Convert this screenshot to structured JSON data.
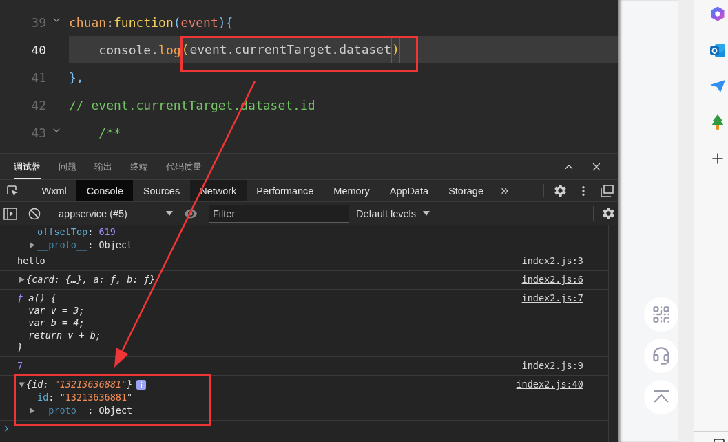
{
  "editor": {
    "lines": [
      {
        "number": "39",
        "foldable": true,
        "current": false,
        "tokens": [
          {
            "text": "chuan",
            "kind": "property"
          },
          {
            "text": ":",
            "kind": "punct"
          },
          {
            "text": "function",
            "kind": "keyword"
          },
          {
            "text": "(",
            "kind": "bracket"
          },
          {
            "text": "event",
            "kind": "param"
          },
          {
            "text": "){",
            "kind": "bracket"
          }
        ]
      },
      {
        "number": "40",
        "foldable": false,
        "current": true,
        "tokens": [
          {
            "text": "    console.",
            "kind": "plain"
          },
          {
            "text": "log",
            "kind": "method"
          },
          {
            "text": "(",
            "kind": "match"
          },
          {
            "text": "event.currentTarget.dataset",
            "kind": "arg"
          },
          {
            "text": ")",
            "kind": "match"
          }
        ]
      },
      {
        "number": "41",
        "foldable": false,
        "current": false,
        "tokens": [
          {
            "text": "},",
            "kind": "bracket"
          }
        ]
      },
      {
        "number": "42",
        "foldable": false,
        "current": false,
        "tokens": [
          {
            "text": "// event.currentTarget.dataset.id",
            "kind": "comment"
          }
        ]
      },
      {
        "number": "43",
        "foldable": true,
        "current": false,
        "tokens": [
          {
            "text": "    /**",
            "kind": "comment"
          }
        ]
      }
    ]
  },
  "panel_tabs": [
    {
      "label": "调试器",
      "selected": true
    },
    {
      "label": "问题",
      "selected": false
    },
    {
      "label": "输出",
      "selected": false
    },
    {
      "label": "终端",
      "selected": false
    },
    {
      "label": "代码质量",
      "selected": false
    }
  ],
  "devtools_tabs": [
    {
      "label": "Wxml",
      "selected": false,
      "hovered": false
    },
    {
      "label": "Console",
      "selected": true,
      "hovered": false
    },
    {
      "label": "Sources",
      "selected": false,
      "hovered": false
    },
    {
      "label": "Network",
      "selected": false,
      "hovered": true
    },
    {
      "label": "Performance",
      "selected": false,
      "hovered": false
    },
    {
      "label": "Memory",
      "selected": false,
      "hovered": false
    },
    {
      "label": "AppData",
      "selected": false,
      "hovered": false
    },
    {
      "label": "Storage",
      "selected": false,
      "hovered": false
    }
  ],
  "console_toolbar": {
    "context": "appservice (#5)",
    "filter": {
      "placeholder": "Filter"
    },
    "levels": "Default levels"
  },
  "console": {
    "messages": [
      {
        "kind": "continuation",
        "info": false,
        "nodes": [
          {
            "kind": "value",
            "tokens": [
              {
                "text": "offsetTop",
                "kind": "key"
              },
              {
                "text": ": ",
                "kind": "plain"
              },
              {
                "text": "619",
                "kind": "number"
              }
            ]
          },
          {
            "kind": "object",
            "expanded": false,
            "tokens": [
              {
                "text": "__proto__",
                "kind": "internal-key"
              },
              {
                "text": ": Object",
                "kind": "plain"
              }
            ]
          }
        ]
      },
      {
        "kind": "log",
        "source": "index2.js:3",
        "info": false,
        "nodes": [
          {
            "kind": "value",
            "tokens": [
              {
                "text": "hello",
                "kind": "plain"
              }
            ]
          }
        ]
      },
      {
        "kind": "log",
        "source": "index2.js:6",
        "info": false,
        "nodes": [
          {
            "kind": "object",
            "expanded": false,
            "tokens": [
              {
                "text": "{card: {…}, a: ƒ, b: ƒ}",
                "kind": "italic"
              }
            ]
          }
        ]
      },
      {
        "kind": "log",
        "source": "index2.js:7",
        "info": false,
        "nodes": [
          {
            "kind": "value",
            "tokens": [
              {
                "text": "ƒ",
                "kind": "function-sign"
              },
              {
                "text": " a() {\n  var v = 3;\n  var b = 4;\n  return v + b;\n}",
                "kind": "italic"
              }
            ]
          }
        ]
      },
      {
        "kind": "log",
        "source": "index2.js:9",
        "info": false,
        "nodes": [
          {
            "kind": "value",
            "tokens": [
              {
                "text": "7",
                "kind": "number"
              }
            ]
          }
        ]
      },
      {
        "kind": "log",
        "source": "index2.js:40",
        "info": true,
        "nodes": [
          {
            "kind": "object",
            "expanded": true,
            "tokens": [
              {
                "text": "{id: ",
                "kind": "italic"
              },
              {
                "text": "\"13213636881\"",
                "kind": "italic-string"
              },
              {
                "text": "}",
                "kind": "italic"
              }
            ],
            "children": [
              {
                "kind": "value",
                "tokens": [
                  {
                    "text": "id",
                    "kind": "key"
                  },
                  {
                    "text": ": \"",
                    "kind": "plain"
                  },
                  {
                    "text": "13213636881",
                    "kind": "string"
                  },
                  {
                    "text": "\"",
                    "kind": "plain"
                  }
                ]
              },
              {
                "kind": "object",
                "expanded": false,
                "tokens": [
                  {
                    "text": "__proto__",
                    "kind": "internal-key"
                  },
                  {
                    "text": ": Object",
                    "kind": "plain"
                  }
                ]
              }
            ]
          }
        ]
      }
    ]
  }
}
